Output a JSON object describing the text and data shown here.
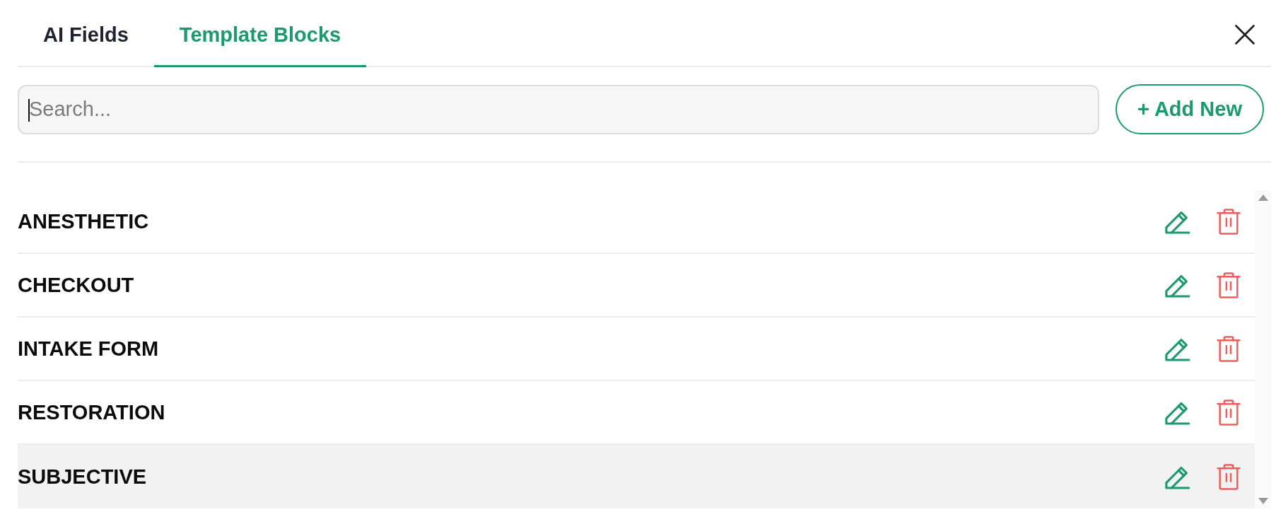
{
  "tabs": [
    {
      "label": "AI Fields",
      "selected": false
    },
    {
      "label": "Template Blocks",
      "selected": true
    }
  ],
  "search": {
    "placeholder": "Search...",
    "focused": true
  },
  "add_button": {
    "label": "+ Add New"
  },
  "blocks": [
    {
      "name": "ANESTHETIC",
      "selected": false
    },
    {
      "name": "CHECKOUT",
      "selected": false
    },
    {
      "name": "INTAKE FORM",
      "selected": false
    },
    {
      "name": "RESTORATION",
      "selected": false
    },
    {
      "name": "SUBJECTIVE",
      "selected": true
    }
  ]
}
